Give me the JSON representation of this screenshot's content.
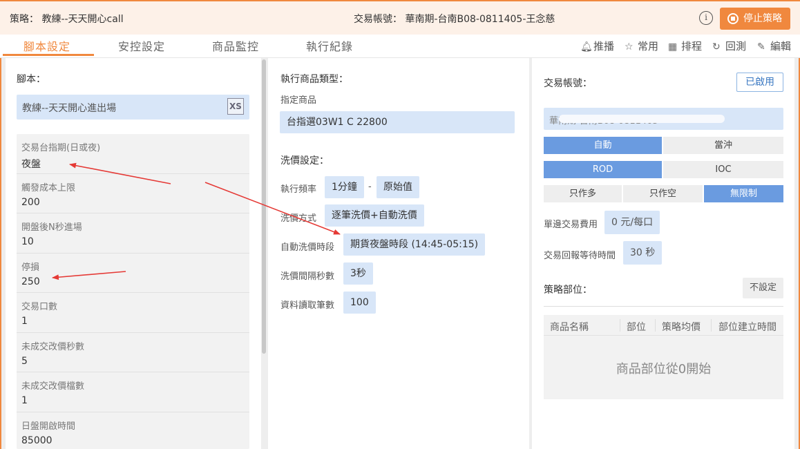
{
  "header": {
    "strategy": "策略：  教練--天天開心call",
    "account": "交易帳號：  華南期-台南B08-0811405-王念慈",
    "info_icon": "info-circle-icon",
    "stop_label": "停止策略",
    "accent": "#f0883e"
  },
  "tabs": [
    {
      "label": "腳本設定",
      "active": true
    },
    {
      "label": "安控設定",
      "active": false
    },
    {
      "label": "商品監控",
      "active": false
    },
    {
      "label": "執行紀錄",
      "active": false
    }
  ],
  "tools": [
    {
      "label": "推播",
      "icon": "bell-icon"
    },
    {
      "label": "常用",
      "icon": "star-icon"
    },
    {
      "label": "排程",
      "icon": "calendar-icon"
    },
    {
      "label": "回測",
      "icon": "refresh-icon"
    },
    {
      "label": "編輯",
      "icon": "pencil-icon"
    }
  ],
  "script_panel": {
    "label": "腳本：",
    "script_name": "教練--天天開心進出場",
    "xs_icon": "XS",
    "params": [
      {
        "name": "交易台指期(日或夜)",
        "value": "夜盤"
      },
      {
        "name": "觸發成本上限",
        "value": "200"
      },
      {
        "name": "開盤後N秒進場",
        "value": "10"
      },
      {
        "name": "停損",
        "value": "250"
      },
      {
        "name": "交易口數",
        "value": "1"
      },
      {
        "name": "未成交改價秒數",
        "value": "5"
      },
      {
        "name": "未成交改價檔數",
        "value": "1"
      },
      {
        "name": "日盤開啟時間",
        "value": "85000"
      }
    ]
  },
  "product_panel": {
    "type_label": "執行商品類型：",
    "specified_label": "指定商品",
    "product": "台指選03W1 C 22800",
    "wash_label": "洗價設定：",
    "freq_label": "執行頻率",
    "freq_value": "1分鐘",
    "freq_dash": "-",
    "freq_source": "原始值",
    "method_label": "洗價方式",
    "method_value": "逐筆洗價+自動洗價",
    "auto_label": "自動洗價時段",
    "auto_value": "期貨夜盤時段 (14:45-05:15)",
    "interval_label": "洗價間隔秒數",
    "interval_value": "3秒",
    "read_label": "資料讀取筆數",
    "read_value": "100"
  },
  "account_panel": {
    "label": "交易帳號：",
    "enabled": "已啟用",
    "account_partial": "華南期-台南B08-0811405",
    "mode": [
      {
        "label": "自動",
        "on": true
      },
      {
        "label": "當沖",
        "on": false
      }
    ],
    "order_type": [
      {
        "label": "ROD",
        "on": true
      },
      {
        "label": "IOC",
        "on": false
      }
    ],
    "direction": [
      {
        "label": "只作多",
        "on": false
      },
      {
        "label": "只作空",
        "on": false
      },
      {
        "label": "無限制",
        "on": true
      }
    ],
    "fee_label": "單邊交易費用",
    "fee_value": "0 元/每口",
    "wait_label": "交易回報等待時間",
    "wait_value": "30 秒",
    "position_label": "策略部位：",
    "no_setting": "不設定",
    "table_headers": [
      "商品名稱",
      "部位",
      "策略均價",
      "部位建立時間"
    ],
    "empty_text": "商品部位從0開始"
  }
}
